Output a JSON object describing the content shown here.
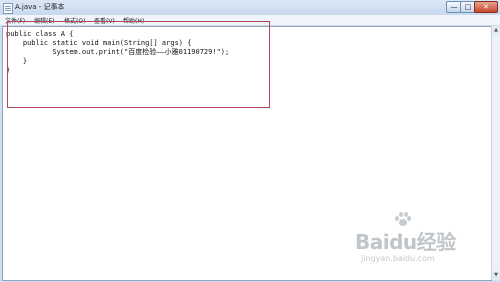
{
  "window": {
    "title": "A.java - 记事本",
    "controls": {
      "minimize": "—",
      "maximize": "□",
      "close": "✕"
    }
  },
  "menu": {
    "items": [
      "文件(F)",
      "编辑(E)",
      "格式(O)",
      "查看(V)",
      "帮助(H)"
    ]
  },
  "editor": {
    "content": "public class A {\n    public static void main(String[] args) {\n           System.out.print(\"百度检验——小雅01190729!\");\n    }\n}"
  },
  "watermark": {
    "brand": "Baidu经验",
    "url": "jingyan.baidu.com"
  },
  "colors": {
    "highlight_border": "#b5455a",
    "titlebar": "#c8d9ee"
  }
}
